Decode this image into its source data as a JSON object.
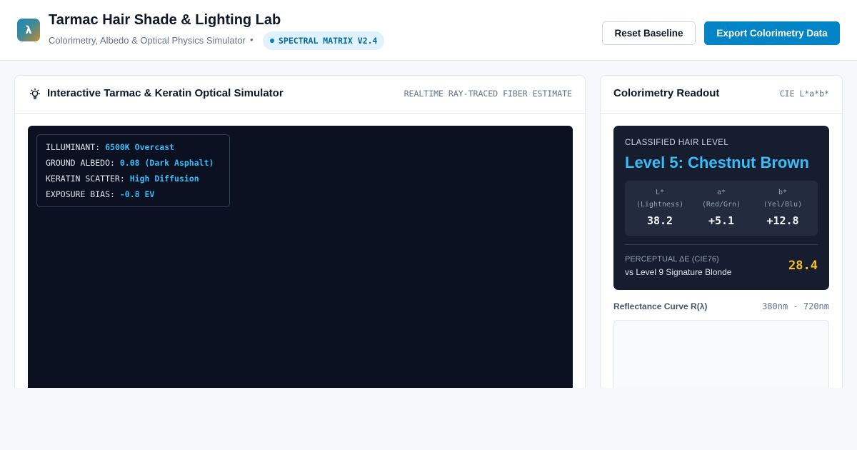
{
  "header": {
    "logo_glyph": "λ",
    "title": "Tarmac Hair Shade & Lighting Lab",
    "subtitle": "Colorimetry, Albedo & Optical Physics Simulator",
    "separator": "•",
    "badge": "SPECTRAL MATRIX V2.4",
    "reset_label": "Reset Baseline",
    "export_label": "Export Colorimetry Data"
  },
  "simulator": {
    "icon": "lightbulb-icon",
    "title": "Interactive Tarmac & Keratin Optical Simulator",
    "meta": "REALTIME RAY-TRACED FIBER ESTIMATE",
    "overlay": [
      {
        "label": "ILLUMINANT:",
        "value": "6500K Overcast"
      },
      {
        "label": "GROUND ALBEDO:",
        "value": "0.08 (Dark Asphalt)"
      },
      {
        "label": "KERATIN SCATTER:",
        "value": "High Diffusion"
      },
      {
        "label": "EXPOSURE BIAS:",
        "value": "-0.8 EV"
      }
    ]
  },
  "readout": {
    "title": "Colorimetry Readout",
    "meta": "CIE L*a*b*",
    "classified_label": "CLASSIFIED HAIR LEVEL",
    "level": "Level 5: Chestnut Brown",
    "lab": [
      {
        "name": "L*",
        "desc": "(Lightness)",
        "value": "38.2"
      },
      {
        "name": "a*",
        "desc": "(Red/Grn)",
        "value": "+5.1"
      },
      {
        "name": "b*",
        "desc": "(Yel/Blu)",
        "value": "+12.8"
      }
    ],
    "delta_label": "PERCEPTUAL ΔE (CIE76)",
    "delta_vs": "vs Level 9 Signature Blonde",
    "delta_value": "28.4",
    "curve_label": "Reflectance Curve R(λ)",
    "curve_range": "380nm - 720nm"
  },
  "colors": {
    "accent": "#0284c7",
    "highlight": "#38bdf8",
    "delta": "#fbbf24",
    "viewport_bg": "#0b1120"
  }
}
